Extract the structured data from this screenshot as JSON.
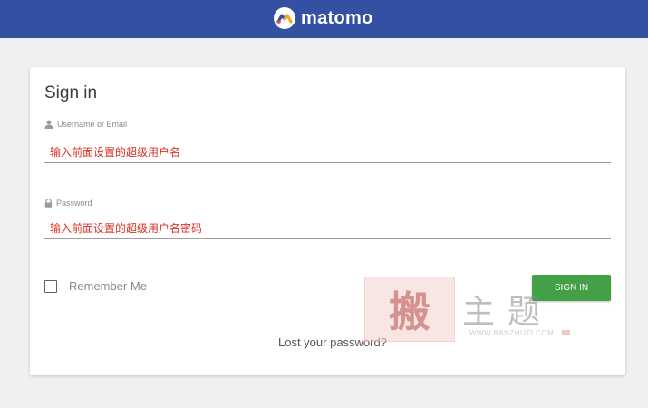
{
  "header": {
    "brand": "matomo",
    "bg_color": "#3450a3"
  },
  "form": {
    "title": "Sign in",
    "username": {
      "label": "Username or Email",
      "icon": "user-icon",
      "value": "输入前面设置的超级用户名"
    },
    "password": {
      "label": "Password",
      "icon": "lock-icon",
      "value": "输入前面设置的超级用户名密码"
    },
    "remember_label": "Remember Me",
    "remember_checked": false,
    "signin_label": "SIGN IN",
    "signin_color": "#43a047",
    "lost_password": "Lost your password?",
    "input_text_color": "#d93025"
  },
  "watermark": {
    "stamp": "搬",
    "chars": "主题",
    "url": "WWW.BANZHUTI.COM"
  }
}
